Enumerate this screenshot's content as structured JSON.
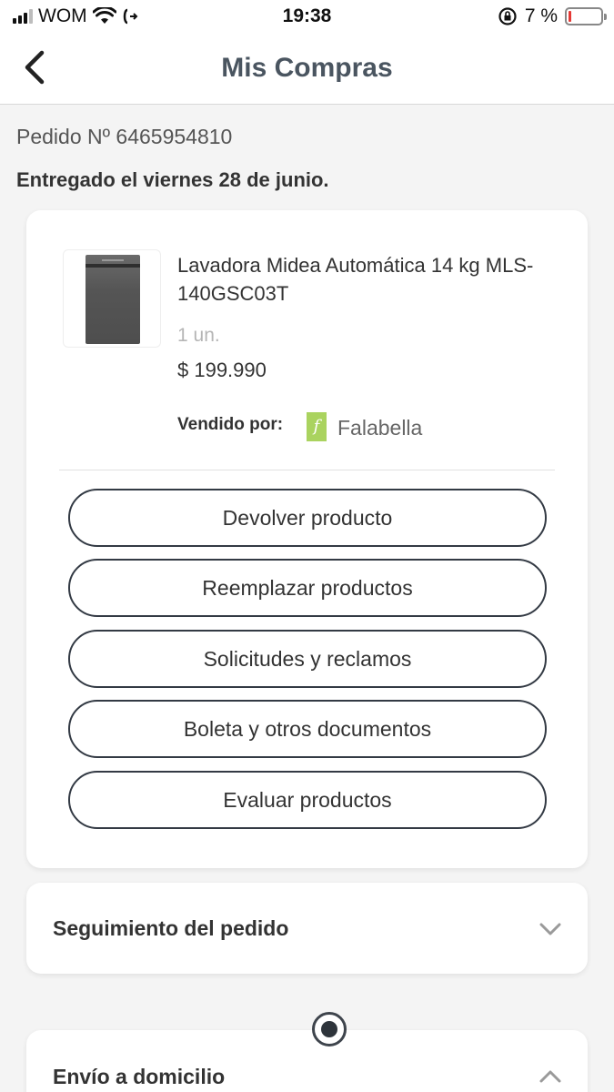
{
  "status_bar": {
    "carrier": "WOM",
    "time": "19:38",
    "battery_text": "7 %",
    "battery_level": 0.07,
    "battery_color": "#e53935"
  },
  "header": {
    "title": "Mis Compras",
    "back_icon": "chevron-left-icon"
  },
  "order": {
    "number_text": "Pedido Nº 6465954810",
    "delivered_text": "Entregado el viernes 28 de junio."
  },
  "product": {
    "name": "Lavadora Midea Automática 14 kg MLS-140GSC03T",
    "quantity": "1 un.",
    "price": "$ 199.990",
    "sold_by_label": "Vendido por:",
    "seller_logo_letter": "f",
    "seller_name": "Falabella",
    "seller_color": "#aad35f"
  },
  "actions": [
    {
      "label": "Devolver producto"
    },
    {
      "label": "Reemplazar productos"
    },
    {
      "label": "Solicitudes y reclamos"
    },
    {
      "label": "Boleta y otros documentos"
    },
    {
      "label": "Evaluar productos"
    }
  ],
  "tracking": {
    "title": "Seguimiento del pedido",
    "icon": "chevron-down-icon"
  },
  "shipping": {
    "title": "Envío a domicilio",
    "icon": "chevron-up-icon"
  }
}
